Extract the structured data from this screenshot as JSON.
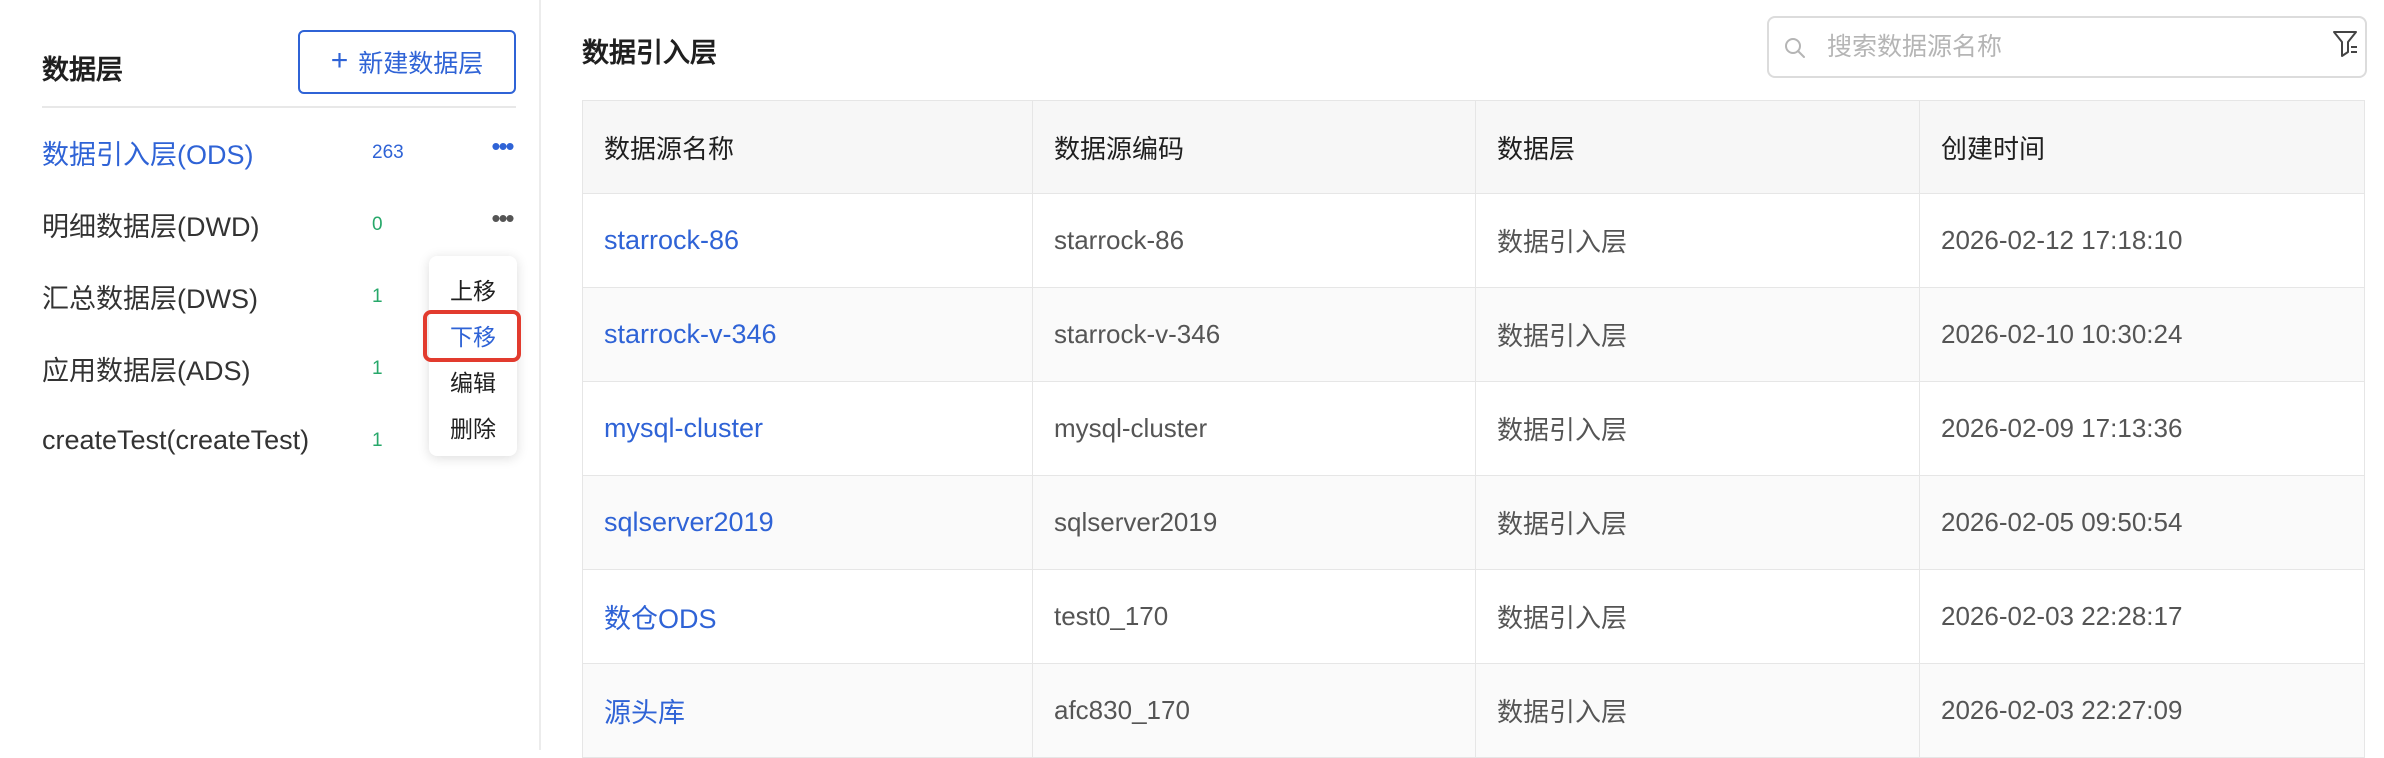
{
  "sidebar": {
    "title": "数据层",
    "new_button_label": "新建数据层",
    "items": [
      {
        "label": "数据引入层(ODS)",
        "count": "263"
      },
      {
        "label": "明细数据层(DWD)",
        "count": "0"
      },
      {
        "label": "汇总数据层(DWS)",
        "count": "1"
      },
      {
        "label": "应用数据层(ADS)",
        "count": "1"
      },
      {
        "label": "createTest(createTest)",
        "count": "1"
      }
    ],
    "more_icon": "•••"
  },
  "context_menu": {
    "items": [
      {
        "label": "上移"
      },
      {
        "label": "下移"
      },
      {
        "label": "编辑"
      },
      {
        "label": "删除"
      }
    ]
  },
  "main": {
    "title": "数据引入层",
    "search": {
      "placeholder": "搜索数据源名称",
      "value": ""
    },
    "table": {
      "headers": [
        "数据源名称",
        "数据源编码",
        "数据层",
        "创建时间"
      ],
      "rows": [
        [
          "starrock-86",
          "starrock-86",
          "数据引入层",
          "2026-02-12 17:18:10"
        ],
        [
          "starrock-v-346",
          "starrock-v-346",
          "数据引入层",
          "2026-02-10 10:30:24"
        ],
        [
          "mysql-cluster",
          "mysql-cluster",
          "数据引入层",
          "2026-02-09 17:13:36"
        ],
        [
          "sqlserver2019",
          "sqlserver2019",
          "数据引入层",
          "2026-02-05 09:50:54"
        ],
        [
          "数仓ODS",
          "test0_170",
          "数据引入层",
          "2026-02-03 22:28:17"
        ],
        [
          "源头库",
          "afc830_170",
          "数据引入层",
          "2026-02-03 22:27:09"
        ]
      ]
    }
  },
  "colors": {
    "accent": "#2f63d6",
    "count_green": "#27a86a",
    "highlight_red": "#e23b2e"
  }
}
